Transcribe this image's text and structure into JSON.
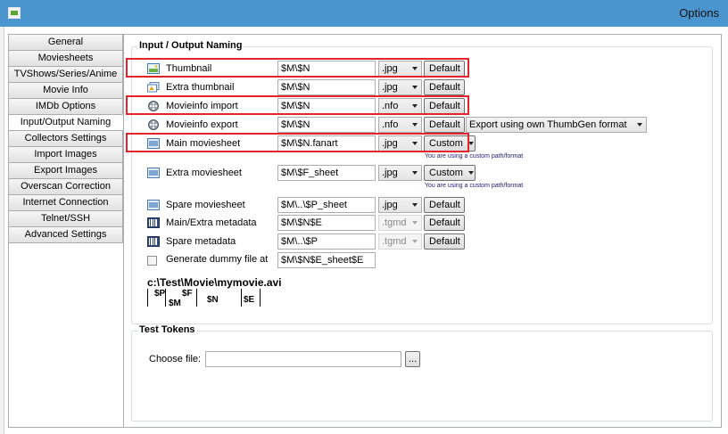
{
  "window": {
    "title": "Options"
  },
  "nav": {
    "items": [
      {
        "label": "General"
      },
      {
        "label": "Moviesheets"
      },
      {
        "label": "TVShows/Series/Anime"
      },
      {
        "label": "Movie Info"
      },
      {
        "label": "IMDb Options"
      },
      {
        "label": "Input/Output Naming"
      },
      {
        "label": "Collectors Settings"
      },
      {
        "label": "Import Images"
      },
      {
        "label": "Export Images"
      },
      {
        "label": "Overscan Correction"
      },
      {
        "label": "Internet Connection"
      },
      {
        "label": "Telnet/SSH"
      },
      {
        "label": "Advanced Settings"
      }
    ],
    "active": "Input/Output Naming"
  },
  "io_group": {
    "title": "Input / Output Naming",
    "rows": [
      {
        "label": "Thumbnail",
        "value": "$M\\$N",
        "ext": ".jpg",
        "button": "Default"
      },
      {
        "label": "Extra thumbnail",
        "value": "$M\\$N",
        "ext": ".jpg",
        "button": "Default"
      },
      {
        "label": "Movieinfo import",
        "value": "$M\\$N",
        "ext": ".nfo",
        "button": "Default"
      },
      {
        "label": "Movieinfo export",
        "value": "$M\\$N",
        "ext": ".nfo",
        "button": "Default",
        "extra": "Export using own ThumbGen format"
      },
      {
        "label": "Main moviesheet",
        "value": "$M\\$N.fanart",
        "ext": ".jpg",
        "button": "Custom",
        "note": "You are using a custom path/format"
      },
      {
        "label": "Extra moviesheet",
        "value": "$M\\$F_sheet",
        "ext": ".jpg",
        "button": "Custom",
        "note": "You are using a custom path/format"
      },
      {
        "label": "Spare moviesheet",
        "value": "$M\\..\\$P_sheet",
        "ext": ".jpg",
        "button": "Default"
      },
      {
        "label": "Main/Extra metadata",
        "value": "$M\\$N$E",
        "ext": ".tgmd",
        "button": "Default"
      },
      {
        "label": "Spare metadata",
        "value": "$M\\..\\$P",
        "ext": ".tgmd",
        "button": "Default"
      }
    ],
    "dummy": {
      "label": "Generate dummy file at",
      "value": "$M\\$N$E_sheet$E"
    },
    "legend": {
      "path_line": "c:\\Test\\Movie\\mymovie.avi",
      "p": "$P",
      "m": "$M",
      "f": "$F",
      "n": "$N",
      "e": "$E"
    }
  },
  "test_group": {
    "title": "Test Tokens",
    "choose_label": "Choose file:",
    "file_value": "",
    "browse_label": "..."
  },
  "icons": {
    "thumbnail": "landscape-picture-icon",
    "extra_thumbnail": "paint-pictures-icon",
    "movieinfo": "film-reel-icon",
    "moviesheet": "sheet-picture-icon",
    "metadata": "barcode-film-icon"
  },
  "colors": {
    "titlebar": "#4b95cf",
    "highlight": "#e5232b"
  }
}
